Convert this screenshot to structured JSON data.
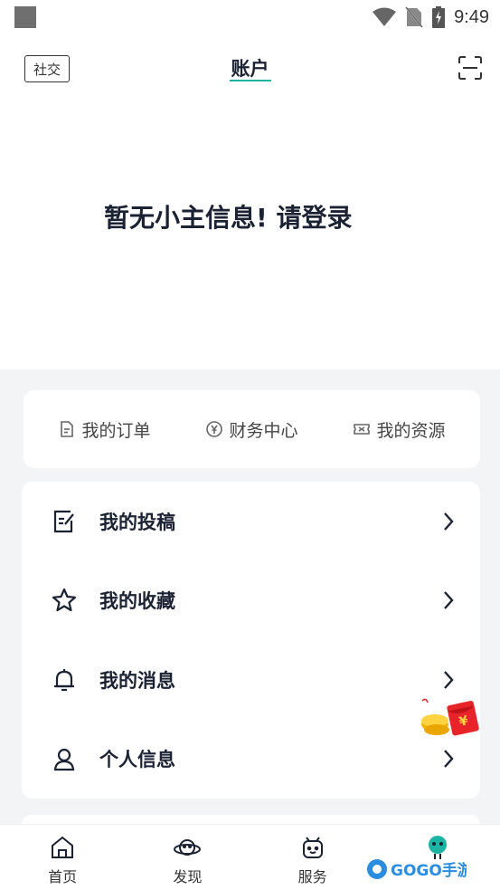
{
  "status_bar": {
    "time": "9:49"
  },
  "header": {
    "social_label": "社交",
    "title": "账户",
    "accent_color": "#1bb3a1"
  },
  "login_prompt": "暂无小主信息! 请登录",
  "quick_actions": [
    {
      "label": "我的订单",
      "icon": "order-doc-icon"
    },
    {
      "label": "财务中心",
      "icon": "yen-coin-icon"
    },
    {
      "label": "我的资源",
      "icon": "ticket-icon"
    }
  ],
  "menu": [
    {
      "label": "我的投稿",
      "icon": "edit-note-icon"
    },
    {
      "label": "我的收藏",
      "icon": "star-icon"
    },
    {
      "label": "我的消息",
      "icon": "bell-icon"
    },
    {
      "label": "个人信息",
      "icon": "user-icon"
    }
  ],
  "bottom_nav": [
    {
      "label": "首页",
      "icon": "home-icon"
    },
    {
      "label": "发现",
      "icon": "planet-icon"
    },
    {
      "label": "服务",
      "icon": "robot-icon"
    },
    {
      "label": "",
      "icon": "avatar-icon"
    }
  ],
  "watermark": {
    "text": "GOGO手游网"
  }
}
